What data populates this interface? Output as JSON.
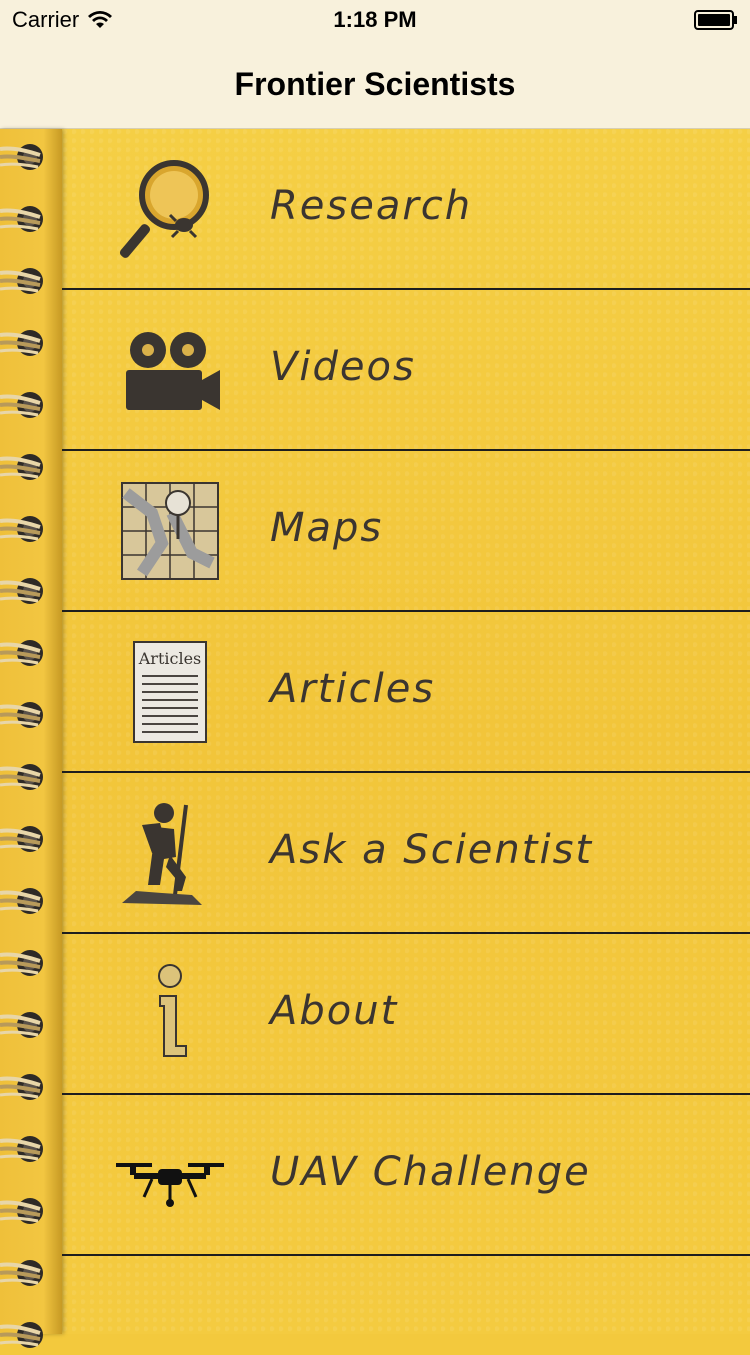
{
  "status_bar": {
    "carrier": "Carrier",
    "time": "1:18 PM"
  },
  "nav": {
    "title": "Frontier Scientists"
  },
  "menu": {
    "items": [
      {
        "label": "Research",
        "icon": "magnifier-bug-icon"
      },
      {
        "label": "Videos",
        "icon": "movie-camera-icon"
      },
      {
        "label": "Maps",
        "icon": "map-pin-icon"
      },
      {
        "label": "Articles",
        "icon": "articles-document-icon",
        "icon_text": "Articles"
      },
      {
        "label": "Ask a Scientist",
        "icon": "hiker-icon"
      },
      {
        "label": "About",
        "icon": "info-icon"
      },
      {
        "label": "UAV Challenge",
        "icon": "drone-icon"
      }
    ]
  },
  "colors": {
    "bar_bg": "#f8f1dc",
    "paper": "#f3c93d",
    "ink": "#3b3530",
    "divider": "#1e1e1e"
  }
}
